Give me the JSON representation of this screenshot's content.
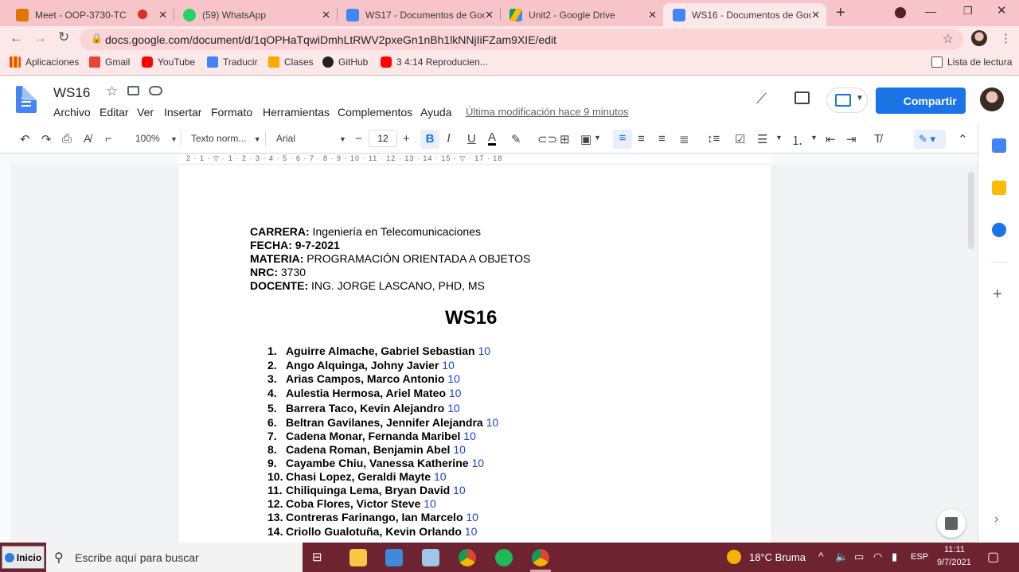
{
  "browser": {
    "tabs": [
      {
        "title": "Meet - OOP-3730-TC",
        "icon": "meet-icon",
        "color": "#e37400"
      },
      {
        "title": "(59) WhatsApp",
        "icon": "whatsapp-icon",
        "color": "#25d366"
      },
      {
        "title": "WS17 - Documentos de Goo",
        "icon": "docs-icon",
        "color": "#4285f4"
      },
      {
        "title": "Unit2 - Google Drive",
        "icon": "drive-icon",
        "color": "#fbbc04"
      },
      {
        "title": "WS16 - Documentos de Goo",
        "icon": "docs-icon",
        "color": "#4285f4",
        "active": true
      }
    ],
    "url": "docs.google.com/document/d/1qOPHaTqwiDmhLtRWV2pxeGn1nBh1lkNNjIiFZam9XIE/edit",
    "bookmarks": [
      {
        "label": "Aplicaciones",
        "icon": "apps-grid-icon"
      },
      {
        "label": "Gmail",
        "icon": "gmail-icon"
      },
      {
        "label": "YouTube",
        "icon": "youtube-icon"
      },
      {
        "label": "Traducir",
        "icon": "translate-icon"
      },
      {
        "label": "Clases",
        "icon": "classroom-icon"
      },
      {
        "label": "GitHub",
        "icon": "github-icon"
      },
      {
        "label": "3 4:14 Reproducien...",
        "icon": "youtube-icon"
      }
    ],
    "reading_list": "Lista de lectura"
  },
  "docs": {
    "title": "WS16",
    "menus": [
      "Archivo",
      "Editar",
      "Ver",
      "Insertar",
      "Formato",
      "Herramientas",
      "Complementos",
      "Ayuda"
    ],
    "last_modified": "Última modificación hace 9 minutos",
    "share_label": "Compartir",
    "zoom": "100%",
    "style": "Texto norm...",
    "font": "Arial",
    "font_size": "12"
  },
  "ruler": {
    "numbers": "2 · 1 · ▽ · 1 · 2 · 3 · 4 · 5 · 6 · 7 · 8 · 9 · 10 · 11 · 12 · 13 · 14 · 15 · ▽ · 17 · 18"
  },
  "document": {
    "header": [
      {
        "label": "CARRERA:",
        "value": " Ingeniería en Telecomunicaciones"
      },
      {
        "label": "FECHA:",
        "value": "  9-7-2021"
      },
      {
        "label": "MATERIA:",
        "value": " PROGRAMACIÓN ORIENTADA A OBJETOS"
      },
      {
        "label": "NRC:",
        "value": " 3730"
      },
      {
        "label": "DOCENTE:",
        "value": " ING. JORGE LASCANO, PHD, MS"
      }
    ],
    "heading": "WS16",
    "students": [
      {
        "n": "1.",
        "name": "Aguirre Almache, Gabriel Sebastian",
        "grade": "10"
      },
      {
        "n": "2.",
        "name": "Ango Alquinga, Johny Javier",
        "grade": "10"
      },
      {
        "n": "3.",
        "name": "Arias Campos, Marco Antonio",
        "grade": "10"
      },
      {
        "n": "4.",
        "name": "Aulestia Hermosa, Ariel Mateo",
        "grade": "10"
      },
      {
        "n": "5.",
        "name": "Barrera Taco, Kevin Alejandro",
        "grade": "10"
      },
      {
        "n": "6.",
        "name": "Beltran Gavilanes, Jennifer Alejandra",
        "grade": "10"
      },
      {
        "n": "7.",
        "name": "Cadena Monar, Fernanda Maribel",
        "grade": "10"
      },
      {
        "n": "8.",
        "name": "Cadena Roman, Benjamin Abel",
        "grade": "10"
      },
      {
        "n": "9.",
        "name": "Cayambe Chiu, Vanessa Katherine",
        "grade": "10"
      },
      {
        "n": "10.",
        "name": "Chasi Lopez, Geraldi Mayte",
        "grade": "10"
      },
      {
        "n": "11.",
        "name": "Chiliquinga Lema, Bryan David",
        "grade": "10"
      },
      {
        "n": "12.",
        "name": "Coba Flores, Victor Steve",
        "grade": "10"
      },
      {
        "n": "13.",
        "name": "Contreras Farinango, Ian Marcelo",
        "grade": "10"
      },
      {
        "n": "14.",
        "name": "Criollo Gualotuña, Kevin Orlando",
        "grade": "10"
      }
    ]
  },
  "taskbar": {
    "start": "Inicio",
    "search_placeholder": "Escribe aquí para buscar",
    "weather": "18°C  Bruma",
    "lang": "ESP",
    "time": "11:11",
    "date": "9/7/2021"
  }
}
